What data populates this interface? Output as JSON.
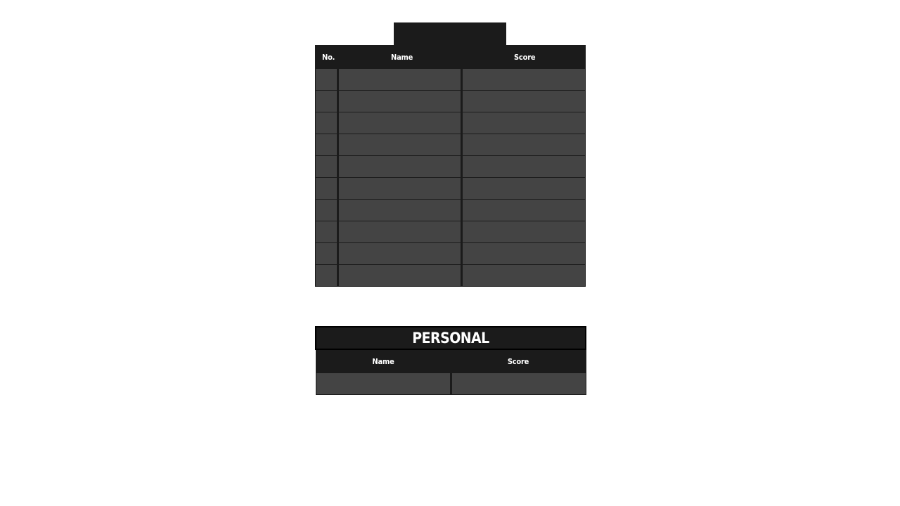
{
  "leaderboard": {
    "headers": {
      "no": "No.",
      "name": "Name",
      "score": "Score"
    },
    "rows": [
      {
        "no": "",
        "name": "",
        "score": ""
      },
      {
        "no": "",
        "name": "",
        "score": ""
      },
      {
        "no": "",
        "name": "",
        "score": ""
      },
      {
        "no": "",
        "name": "",
        "score": ""
      },
      {
        "no": "",
        "name": "",
        "score": ""
      },
      {
        "no": "",
        "name": "",
        "score": ""
      },
      {
        "no": "",
        "name": "",
        "score": ""
      },
      {
        "no": "",
        "name": "",
        "score": ""
      },
      {
        "no": "",
        "name": "",
        "score": ""
      },
      {
        "no": "",
        "name": "",
        "score": ""
      }
    ]
  },
  "personal": {
    "title": "PERSONAL",
    "headers": {
      "name": "Name",
      "score": "Score"
    },
    "row": {
      "name": "",
      "score": ""
    }
  },
  "colors": {
    "header_bg": "#1b1b1b",
    "cell_bg": "#444444",
    "text": "#ffffff",
    "page_bg": "#ffffff"
  }
}
